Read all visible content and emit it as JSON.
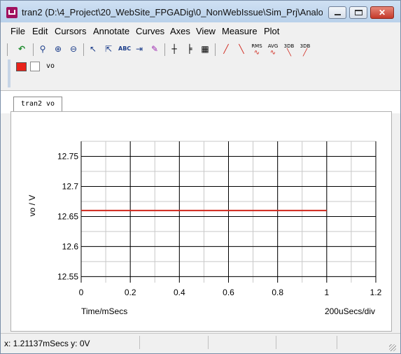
{
  "window": {
    "title": "tran2 (D:\\4_Project\\20_WebSite_FPGADig\\0_NonWebIssue\\Sim_Prj\\Analo...",
    "close_label": "✕"
  },
  "menu": [
    "File",
    "Edit",
    "Cursors",
    "Annotate",
    "Curves",
    "Axes",
    "View",
    "Measure",
    "Plot"
  ],
  "toolbar": {
    "icons": [
      "undo-icon",
      "zoom-fit-icon",
      "zoom-in-icon",
      "zoom-out-icon",
      "cursor-select-icon",
      "cursor-measure-icon",
      "label-abc-icon",
      "add-trace-icon",
      "trace-mark-icon",
      "grid-vertical-icon",
      "grid-horizontal-icon",
      "grid-xy-icon",
      "rise-edge-icon",
      "fall-edge-icon",
      "rms-icon",
      "avg-icon",
      "3db-low-icon",
      "3db-high-icon"
    ],
    "rms_label": "RMS",
    "avg_label": "AVG",
    "db3_label": "3DB",
    "db3b_label": "3DB"
  },
  "legend": {
    "series_label": "vo",
    "swatch_color": "#e8221a"
  },
  "tab": {
    "label": "tran2 vo"
  },
  "chart_data": {
    "type": "line",
    "xlabel": "Time/mSecs",
    "ylabel": "vo / V",
    "x_div_label": "200uSecs/div",
    "xlim": [
      0,
      1.2
    ],
    "ylim": [
      12.54,
      12.775
    ],
    "x_ticks": [
      "0",
      "0.2",
      "0.4",
      "0.6",
      "0.8",
      "1",
      "1.2"
    ],
    "y_ticks": [
      "12.55",
      "12.6",
      "12.65",
      "12.7",
      "12.75"
    ],
    "grid": true,
    "series": [
      {
        "color": "#d0271c",
        "x": [
          0,
          1
        ],
        "y": [
          12.66,
          12.66
        ]
      }
    ]
  },
  "status": {
    "cursor_text": "x: 1.21137mSecs  y: 0V"
  }
}
